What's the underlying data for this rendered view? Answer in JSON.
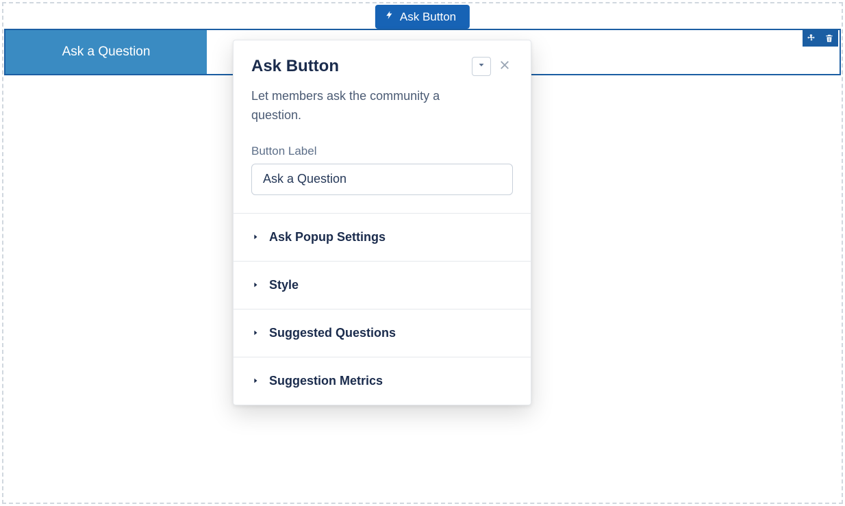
{
  "component_tag": {
    "label": "Ask Button"
  },
  "component": {
    "button_text": "Ask a Question"
  },
  "panel": {
    "title": "Ask Button",
    "description": "Let members ask the community a question.",
    "button_label_field": {
      "label": "Button Label",
      "value": "Ask a Question"
    },
    "sections": [
      {
        "label": "Ask Popup Settings"
      },
      {
        "label": "Style"
      },
      {
        "label": "Suggested Questions"
      },
      {
        "label": "Suggestion Metrics"
      }
    ]
  }
}
